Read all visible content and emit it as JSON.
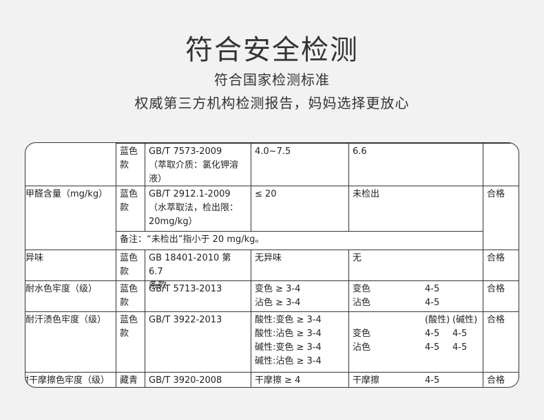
{
  "header": {
    "title": "符合安全检测",
    "subtitle1": "符合国家检测标准",
    "subtitle2": "权威第三方机构检测报告，妈妈选择更放心"
  },
  "table": {
    "r0": {
      "item": "",
      "color": "蓝色款",
      "std": [
        "GB/T 7573-2009",
        "（萃取介质：氯化钾溶",
        "液）"
      ],
      "req": "4.0~7.5",
      "result": "6.6",
      "verdict": ""
    },
    "r1": {
      "item": "甲醛含量（mg/kg）",
      "color": "蓝色款",
      "std": [
        "GB/T 2912.1-2009",
        "（水萃取法，检出限：",
        "20mg/kg）"
      ],
      "req": "≤ 20",
      "result": "未检出",
      "verdict": "合格"
    },
    "note": "备注：“未检出”指小于 20 mg/kg。",
    "r2": {
      "item": "异味",
      "color": "蓝色款",
      "std": [
        "GB 18401-2010  第 6.7",
        "条款"
      ],
      "req": "无异味",
      "result": "无",
      "verdict": "合格"
    },
    "r3": {
      "item": "耐水色牢度（级）",
      "color": "蓝色款",
      "std": [
        "GB/T 5713-2013"
      ],
      "req": [
        "变色 ≥ 3-4",
        "沾色 ≥ 3-4"
      ],
      "result": [
        [
          "变色",
          "4-5"
        ],
        [
          "沾色",
          "4-5"
        ]
      ],
      "verdict": "合格"
    },
    "r4": {
      "item": "耐汗渍色牢度（级）",
      "color": "蓝色款",
      "std": [
        "GB/T 3922-2013"
      ],
      "req": [
        "酸性:变色 ≥ 3-4",
        "酸性:沾色 ≥ 3-4",
        "碱性:变色 ≥ 3-4",
        "碱性:沾色 ≥ 3-4"
      ],
      "result_head": [
        "(酸性)",
        "(碱性)"
      ],
      "result": [
        [
          "变色",
          "4-5",
          "4-5"
        ],
        [
          "沾色",
          "4-5",
          "4-5"
        ]
      ],
      "verdict": "合格"
    },
    "r5": {
      "item": "耐干摩擦色牢度（级）",
      "color": "藏青",
      "std": [
        "GB/T 3920-2008"
      ],
      "req": "干摩擦 ≥ 4",
      "result": [
        "干摩擦",
        "4-5"
      ],
      "verdict": "合格"
    }
  }
}
